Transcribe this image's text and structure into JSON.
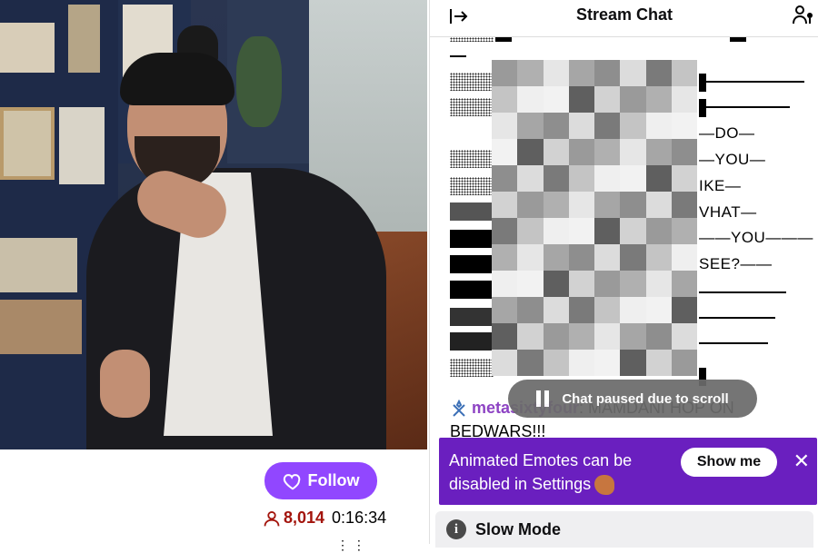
{
  "stream": {
    "follow_label": "Follow",
    "viewer_count": "8,014",
    "uptime": "0:16:34",
    "more_marks": "⋮ ⋮"
  },
  "chat": {
    "title": "Stream Chat",
    "ascii_lines": [
      "—DO—",
      "—YOU—",
      "IKE—",
      "VHAT—",
      "——YOU———",
      "SEE?——"
    ],
    "paused_label": "Chat paused due to scroll",
    "message": {
      "username": "metasixtyfour",
      "text": ": MAMDANI HOP ON BEDWARS!!!"
    },
    "promo": {
      "text": "Animated Emotes can be disabled in Settings",
      "button": "Show me",
      "close": "✕"
    },
    "slow_mode": "Slow Mode"
  },
  "colors": {
    "brand_purple": "#9147ff",
    "promo_bg": "#6a1fbf",
    "viewer_red": "#a3140c",
    "username_purple": "#8e44c4"
  },
  "icons": [
    "collapse-chat-icon",
    "community-users-icon",
    "heart-icon",
    "viewers-icon",
    "pause-icon",
    "info-icon",
    "close-icon"
  ]
}
